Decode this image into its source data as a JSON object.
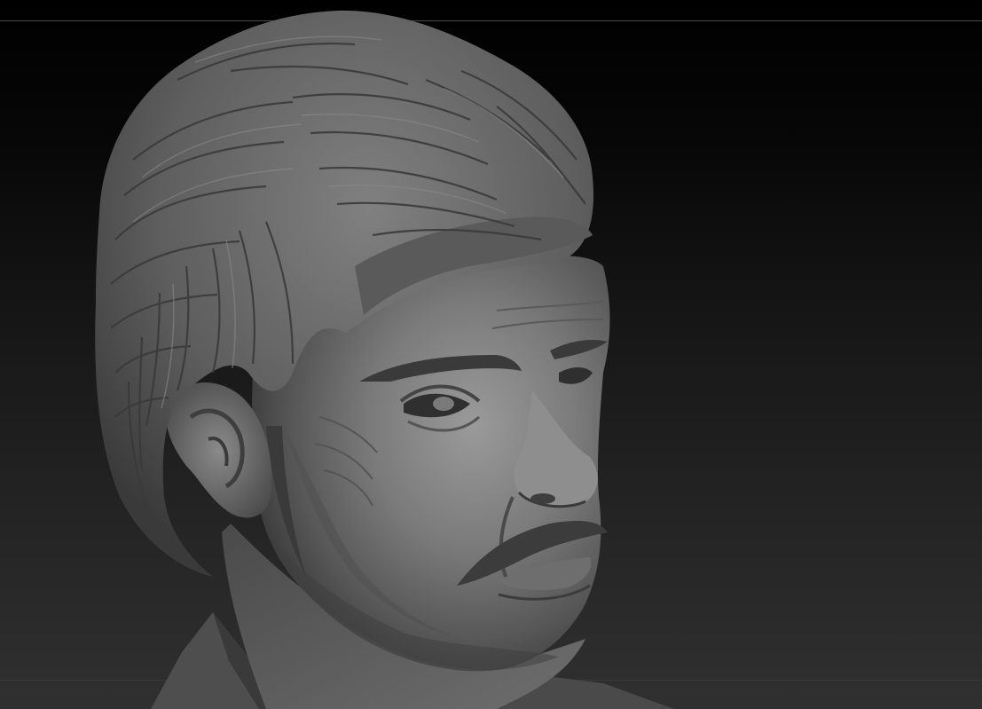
{
  "app": {
    "viewport_background_top": "#000000",
    "viewport_background_bottom": "#303030",
    "material": "matcap-gray",
    "material_color": "#6e6e6e"
  },
  "model": {
    "subject": "sculpted-male-head-bust",
    "icon": "sculpt-mesh-icon"
  }
}
